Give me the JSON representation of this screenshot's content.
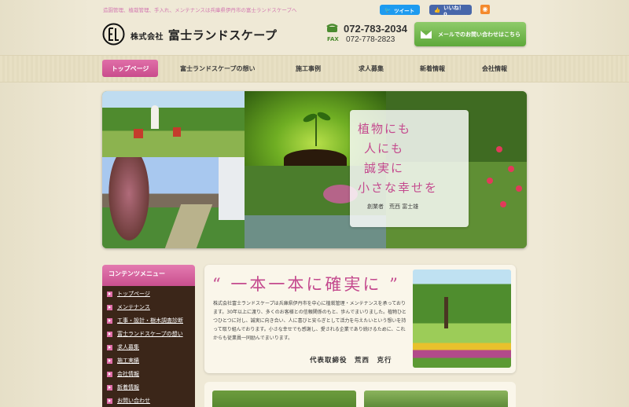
{
  "header": {
    "tagline": "造園管理、植栽管理、手入れ、メンテナンスは兵庫県伊丹市の富士ランドスケープへ",
    "tweet_label": "ツイート",
    "like_label": "いいね！ 0",
    "company_prefix": "株式会社",
    "company_name": "富士ランドスケープ",
    "phone": "072-783-2034",
    "fax_label": "FAX",
    "fax": "072-778-2823",
    "mail_button": "メールでのお問い合わせはこちら"
  },
  "nav": {
    "items": [
      "トップページ",
      "富士ランドスケープの想い",
      "施工事例",
      "求人募集",
      "新着情報",
      "会社情報"
    ]
  },
  "hero": {
    "lines": [
      "植物にも",
      "人にも",
      "誠実に",
      "小さな幸せを"
    ],
    "signature": "創業者　荒西 富士雄"
  },
  "sidebar": {
    "heading": "コンテンツメニュー",
    "items": [
      "トップページ",
      "メンテナンス",
      "工事・設計・樹木調査診断",
      "富士ランドスケープの想い",
      "求人募集",
      "施工実績",
      "会社情報",
      "新着情報",
      "お問い合わせ"
    ]
  },
  "message": {
    "title": "“ 一本一本に確実に ”",
    "body": "株式会社富士ランドスケープは兵庫県伊丹市を中心に植栽管理・メンテナンスを承っております。30年以上に渡り、多くのお客様との信頼関係のもと、歩んでまいりました。植物ひとつひとつに対し、誠実に向き合い、人に喜びと安らぎとして活力を与えたいという想いを持って取り組んでおります。小さな幸せでも感謝し、愛される企業であり続けるために、これからも従業員一同励んでまいります。",
    "signature": "代表取締役　荒西　克行"
  },
  "colors": {
    "pink": "#c94c8c",
    "green": "#5ea83a",
    "brown": "#3b2619"
  }
}
